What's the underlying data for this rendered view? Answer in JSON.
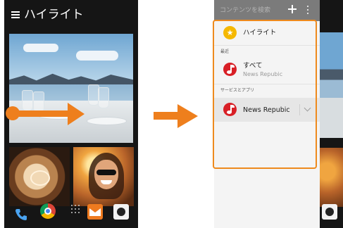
{
  "left": {
    "title": "ハイライト",
    "icons": {
      "menu": "menu-icon",
      "dock": [
        "phone-icon",
        "chrome-icon",
        "apps-icon",
        "mail-icon",
        "camera-icon"
      ]
    }
  },
  "right": {
    "search_placeholder": "コンテンツを検索",
    "highlight_label": "ハイライト",
    "recent_header": "最近",
    "all_label": "すべて",
    "all_source": "News Repubic",
    "services_header": "サービスとアプリ",
    "news_label": "News Repubic",
    "icons": {
      "add": "add-icon",
      "more": "more-icon",
      "star": "star-icon",
      "news": "news-republic-icon",
      "chevron": "chevron-down-icon"
    }
  },
  "colors": {
    "accent_orange": "#ee7f1d",
    "header_gray": "#7b7b7b",
    "star_yellow": "#f5b800",
    "news_red": "#d81f26",
    "phone_dark": "#151515"
  }
}
